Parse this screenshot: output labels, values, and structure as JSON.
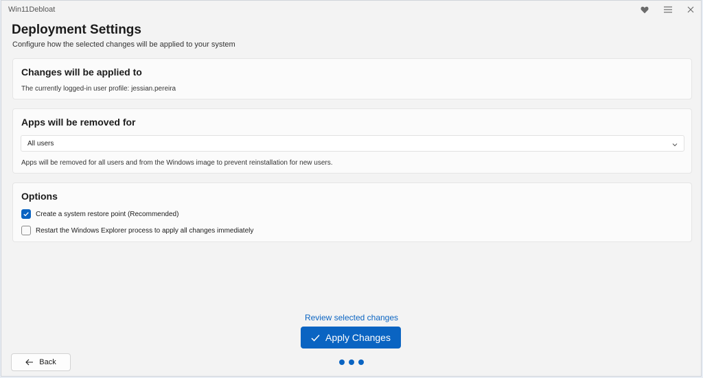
{
  "window": {
    "title": "Win11Debloat",
    "controls": [
      {
        "name": "heart-icon",
        "glyph": "♥"
      },
      {
        "name": "menu-icon",
        "glyph": "☰"
      },
      {
        "name": "close-icon",
        "glyph": "✕"
      }
    ]
  },
  "header": {
    "title": "Deployment Settings",
    "subtitle": "Configure how the selected changes will be applied to your system"
  },
  "applied_card": {
    "heading": "Changes will be applied to",
    "text": "The currently logged-in user profile: jessian.pereira"
  },
  "apps_card": {
    "heading": "Apps will be removed for",
    "dropdown_value": "All users",
    "description": "Apps will be removed for all users and from the Windows image to prevent reinstallation for new users."
  },
  "options_card": {
    "heading": "Options",
    "items": [
      {
        "label": "Create a system restore point (Recommended)",
        "checked": true
      },
      {
        "label": "Restart the Windows Explorer process to apply all changes immediately",
        "checked": false
      }
    ]
  },
  "footer": {
    "review_link": "Review selected changes",
    "apply_label": "Apply Changes",
    "back_label": "Back",
    "progress_steps": 3
  },
  "colors": {
    "accent": "#0a64c2",
    "window_bg": "#f3f3f3",
    "card_bg": "#fbfbfb"
  }
}
